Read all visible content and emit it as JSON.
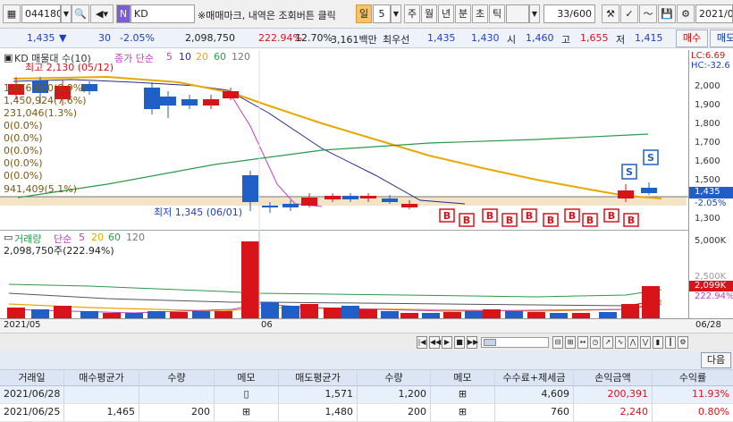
{
  "toolbar": {
    "stock_code": "044180",
    "stock_name": "KD",
    "notice": "※매매마크, 내역은 조회버튼 클릭",
    "period_selected": "일",
    "period_value": "5",
    "period_tabs": [
      "주",
      "월",
      "년",
      "분",
      "초",
      "틱"
    ],
    "count": "33/600",
    "date": "2021/06/28"
  },
  "quote": {
    "price": "1,435",
    "change": "30",
    "change_pct": "-2.05%",
    "volume": "2,098,750",
    "volume_ratio": "222.94%",
    "turnover": "12.70%",
    "amount": "3,161백만",
    "best_label": "최우선",
    "best_ask": "1,435",
    "best_bid": "1,430",
    "open_label": "시",
    "open": "1,460",
    "high_label": "고",
    "high": "1,655",
    "low_label": "저",
    "low": "1,415",
    "buy_btn": "매수",
    "sell_btn": "매도"
  },
  "price_panel": {
    "title": "KD 매물대 수(10)",
    "ma_label": "종가 단순",
    "ma_periods": [
      "5",
      "10",
      "20",
      "60",
      "120"
    ],
    "high_mark": "최고 2,130 (05/12)",
    "low_mark": "최저 1,345 (06/01)",
    "volume_profile": [
      "1,676,600(8.9%)",
      "1,450,924(7.6%)",
      "231,046(1.3%)",
      "0(0.0%)",
      "0(0.0%)",
      "0(0.0%)",
      "0(0.0%)",
      "0(0.0%)",
      "941,409(5.1%)"
    ],
    "lc_label": "LC:6.69",
    "hc_label": "HC:-32.6",
    "axis_ticks": [
      "2,000",
      "1,900",
      "1,800",
      "1,700",
      "1,600",
      "1,500",
      "1,300"
    ],
    "current_price": "1,435",
    "current_pct": "-2.05%",
    "buy_mark": "B",
    "sell_mark": "S"
  },
  "vol_panel": {
    "title": "거래량",
    "ma_label": "단순",
    "ma_periods": [
      "5",
      "20",
      "60",
      "120"
    ],
    "value_label": "2,098,750주(222.94%)",
    "axis_ticks": [
      "5,000K",
      "2,500K"
    ],
    "current": "2,099K",
    "current_pct": "222.94%"
  },
  "datebar": {
    "left": "2021/05",
    "mid": "06",
    "right": "06/28"
  },
  "table": {
    "next_btn": "다음",
    "headers": [
      "거래일",
      "매수평균가",
      "수량",
      "메모",
      "매도평균가",
      "수량",
      "메모",
      "수수료+제세금",
      "손익금액",
      "수익률"
    ],
    "rows": [
      [
        "2021/06/28",
        "",
        "",
        "",
        "1,571",
        "1,200",
        "",
        "4,609",
        "200,391",
        "11.93%"
      ],
      [
        "2021/06/25",
        "1,465",
        "200",
        "",
        "1,480",
        "200",
        "",
        "760",
        "2,240",
        "0.80%"
      ]
    ]
  },
  "colors": {
    "up": "#d8141a",
    "down": "#1f5fc7",
    "ma5": "#c040c0",
    "ma10": "#2a2a8a",
    "ma20": "#e8a800",
    "ma60": "#2a9a4a"
  }
}
